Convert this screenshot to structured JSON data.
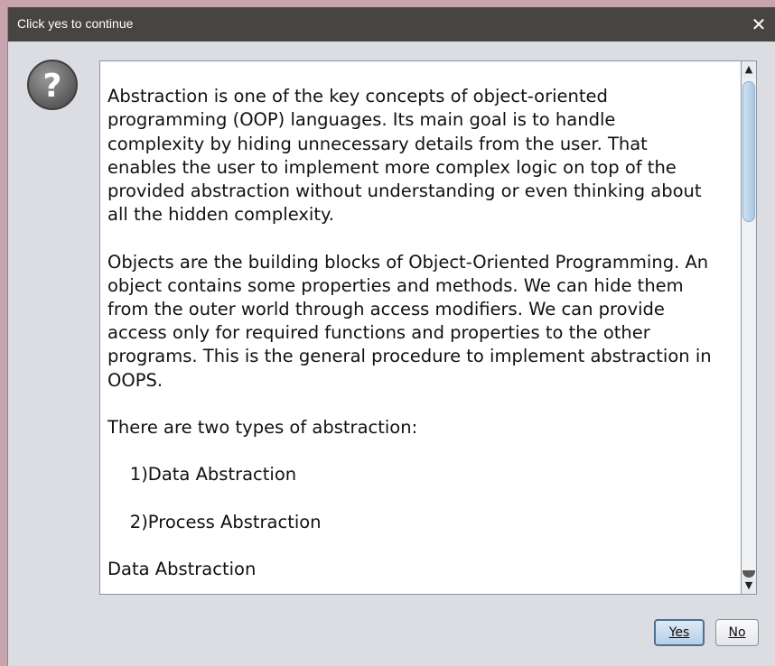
{
  "window": {
    "title": "Click yes to continue",
    "close_icon": "close-icon"
  },
  "icon": {
    "name": "question-icon",
    "glyph": "?"
  },
  "message": {
    "text": "\nAbstraction is one of the key concepts of object-oriented\nprogramming (OOP) languages. Its main goal is to handle\ncomplexity by hiding unnecessary details from the user. That\nenables the user to implement more complex logic on top of the\nprovided abstraction without understanding or even thinking about\nall the hidden complexity.\n\nObjects are the building blocks of Object-Oriented Programming. An\nobject contains some properties and methods. We can hide them\nfrom the outer world through access modifiers. We can provide\naccess only for required functions and properties to the other\nprograms. This is the general procedure to implement abstraction in\nOOPS.\n\nThere are two types of abstraction:\n\n    1)Data Abstraction\n\n    2)Process Abstraction\n\nData Abstraction"
  },
  "scrollbar": {
    "up_glyph": "▲",
    "down_glyph": "▼"
  },
  "buttons": {
    "yes_label": "Yes",
    "no_label": "No"
  }
}
